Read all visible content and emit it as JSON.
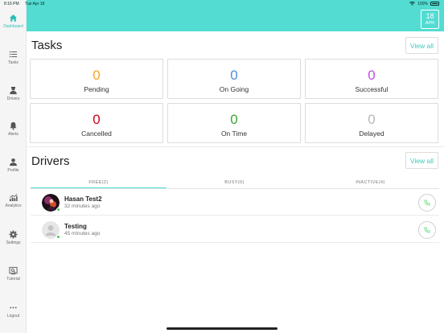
{
  "status_bar": {
    "time": "8:16 PM",
    "date": "Tue Apr 18",
    "battery": "100%"
  },
  "header": {
    "date_badge": {
      "day": "18",
      "month": "APR"
    }
  },
  "sidebar": {
    "items": [
      {
        "label": "Dashboard",
        "icon": "home-icon"
      },
      {
        "label": "Tasks",
        "icon": "list-icon"
      },
      {
        "label": "Drivers",
        "icon": "driver-icon"
      },
      {
        "label": "Alerts",
        "icon": "bell-icon"
      },
      {
        "label": "Profile",
        "icon": "user-icon"
      },
      {
        "label": "Analytics",
        "icon": "analytics-icon"
      },
      {
        "label": "Settings",
        "icon": "gear-icon"
      },
      {
        "label": "Tutorial",
        "icon": "tutorial-icon"
      },
      {
        "label": "Logout",
        "icon": "more-icon"
      }
    ],
    "active_color": "#2bbfb5"
  },
  "tasks": {
    "title": "Tasks",
    "view_all": "View all",
    "cards": [
      {
        "value": "0",
        "label": "Pending",
        "color": "#f5a623"
      },
      {
        "value": "0",
        "label": "On Going",
        "color": "#4a90d9"
      },
      {
        "value": "0",
        "label": "Successful",
        "color": "#c04de0"
      },
      {
        "value": "0",
        "label": "Cancelled",
        "color": "#d0021b"
      },
      {
        "value": "0",
        "label": "On Time",
        "color": "#3aa635"
      },
      {
        "value": "0",
        "label": "Delayed",
        "color": "#b8b8b8"
      }
    ]
  },
  "drivers": {
    "title": "Drivers",
    "view_all": "View all",
    "tabs": [
      {
        "label": "FREE(2)"
      },
      {
        "label": "BUSY(0)"
      },
      {
        "label": "INACTIVE(4)"
      }
    ],
    "list": [
      {
        "name": "Hasan Test2",
        "time": "32 minutes ago"
      },
      {
        "name": "Testing",
        "time": "45 minutes ago"
      }
    ]
  },
  "colors": {
    "accent": "#52dcd2",
    "link": "#3fc9c0",
    "online": "#3fcf5a"
  }
}
